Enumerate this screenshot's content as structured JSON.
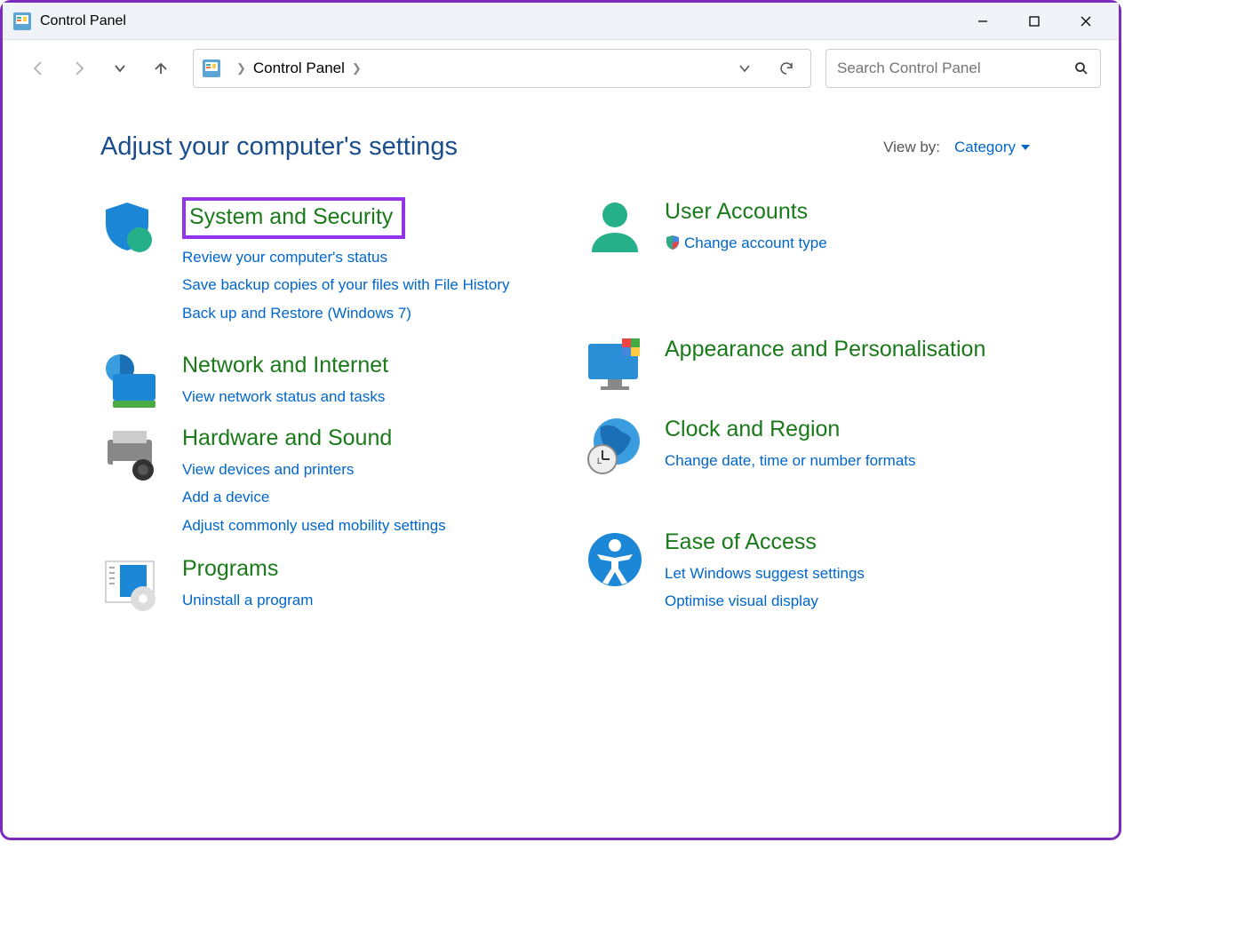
{
  "window": {
    "title": "Control Panel"
  },
  "address": {
    "location": "Control Panel"
  },
  "search": {
    "placeholder": "Search Control Panel"
  },
  "heading": "Adjust your computer's settings",
  "view_by": {
    "label": "View by:",
    "value": "Category"
  },
  "cats": {
    "system": {
      "title": "System and Security",
      "links": [
        "Review your computer's status",
        "Save backup copies of your files with File History",
        "Back up and Restore (Windows 7)"
      ]
    },
    "network": {
      "title": "Network and Internet",
      "links": [
        "View network status and tasks"
      ]
    },
    "hardware": {
      "title": "Hardware and Sound",
      "links": [
        "View devices and printers",
        "Add a device",
        "Adjust commonly used mobility settings"
      ]
    },
    "programs": {
      "title": "Programs",
      "links": [
        "Uninstall a program"
      ]
    },
    "user": {
      "title": "User Accounts",
      "links": [
        "Change account type"
      ]
    },
    "appearance": {
      "title": "Appearance and Personalisation",
      "links": []
    },
    "clock": {
      "title": "Clock and Region",
      "links": [
        "Change date, time or number formats"
      ]
    },
    "ease": {
      "title": "Ease of Access",
      "links": [
        "Let Windows suggest settings",
        "Optimise visual display"
      ]
    }
  }
}
